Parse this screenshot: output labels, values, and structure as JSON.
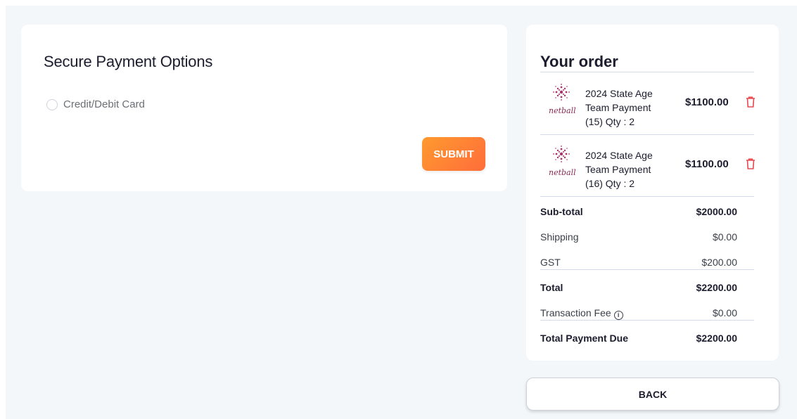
{
  "payment": {
    "title": "Secure Payment Options",
    "option_label": "Credit/Debit Card",
    "submit_label": "SUBMIT"
  },
  "order": {
    "title": "Your order",
    "items": [
      {
        "name": "2024 State Age Team Payment (15) Qty : 2",
        "price": "$1100.00",
        "logo_text": "netball",
        "icon": "trash-icon"
      },
      {
        "name": "2024 State Age Team Payment (16) Qty : 2",
        "price": "$1100.00",
        "logo_text": "netball",
        "icon": "trash-icon"
      }
    ],
    "summary": {
      "subtotal_label": "Sub-total",
      "subtotal_value": "$2000.00",
      "shipping_label": "Shipping",
      "shipping_value": "$0.00",
      "gst_label": "GST",
      "gst_value": "$200.00",
      "total_label": "Total",
      "total_value": "$2200.00",
      "fee_label": "Transaction Fee",
      "fee_value": "$0.00",
      "due_label": "Total Payment Due",
      "due_value": "$2200.00"
    }
  },
  "back_label": "BACK",
  "colors": {
    "accent_start": "#ff9a2e",
    "accent_end": "#ff6d3b",
    "trash": "#e5484d",
    "logo": "#8a2a55"
  }
}
